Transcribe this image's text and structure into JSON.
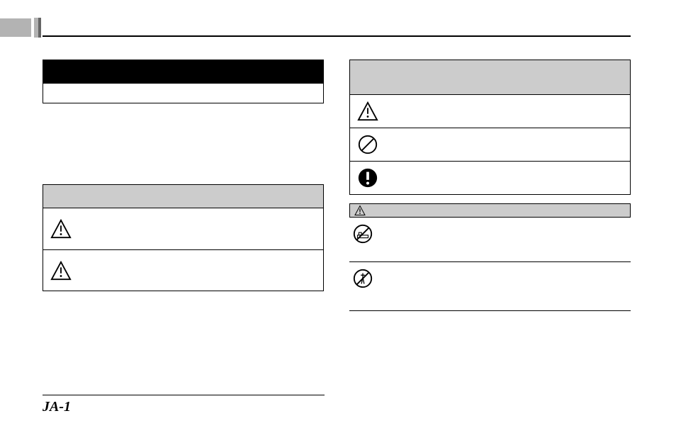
{
  "page_number": "JA-1",
  "icons": {
    "warning": "warning-triangle-icon",
    "prohibit": "prohibit-circle-icon",
    "mandatory": "mandatory-circle-icon",
    "no_wet": "no-wet-hands-icon",
    "no_disassemble": "no-disassemble-icon"
  }
}
